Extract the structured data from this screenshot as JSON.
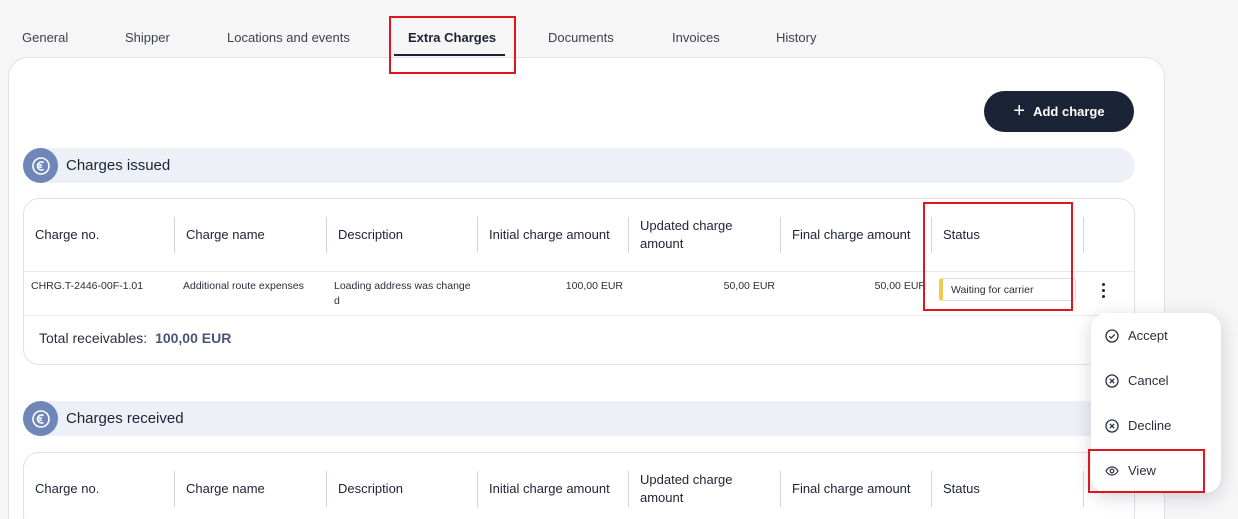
{
  "tabs": [
    {
      "label": "General"
    },
    {
      "label": "Shipper"
    },
    {
      "label": "Locations and events"
    },
    {
      "label": "Extra Charges",
      "active": true
    },
    {
      "label": "Documents"
    },
    {
      "label": "Invoices"
    },
    {
      "label": "History"
    }
  ],
  "toolbar": {
    "add_charge_label": "Add charge"
  },
  "charges_issued": {
    "title": "Charges issued",
    "columns": [
      "Charge no.",
      "Charge name",
      "Description",
      "Initial charge amount",
      "Updated charge amount",
      "Final charge amount",
      "Status"
    ],
    "rows": [
      {
        "charge_no": "CHRG.T-2446-00F-1.01",
        "charge_name": "Additional route expenses",
        "description": "Loading address was changed",
        "initial": "100,00 EUR",
        "updated": "50,00 EUR",
        "final": "50,00 EUR",
        "status": "Waiting for carrier",
        "status_color": "#f2c94c"
      }
    ],
    "total_label": "Total receivables:",
    "total_value": "100,00 EUR"
  },
  "charges_received": {
    "title": "Charges received",
    "columns": [
      "Charge no.",
      "Charge name",
      "Description",
      "Initial charge amount",
      "Updated charge amount",
      "Final charge amount",
      "Status"
    ]
  },
  "row_menu": {
    "items": [
      {
        "label": "Accept",
        "icon": "check-circle-icon"
      },
      {
        "label": "Cancel",
        "icon": "x-circle-icon"
      },
      {
        "label": "Decline",
        "icon": "x-circle-icon"
      },
      {
        "label": "View",
        "icon": "eye-icon"
      }
    ]
  },
  "colors": {
    "primary": "#1b2337",
    "accent": "#6f86b8",
    "highlight": "#e0161d",
    "status_waiting": "#f2c94c"
  }
}
